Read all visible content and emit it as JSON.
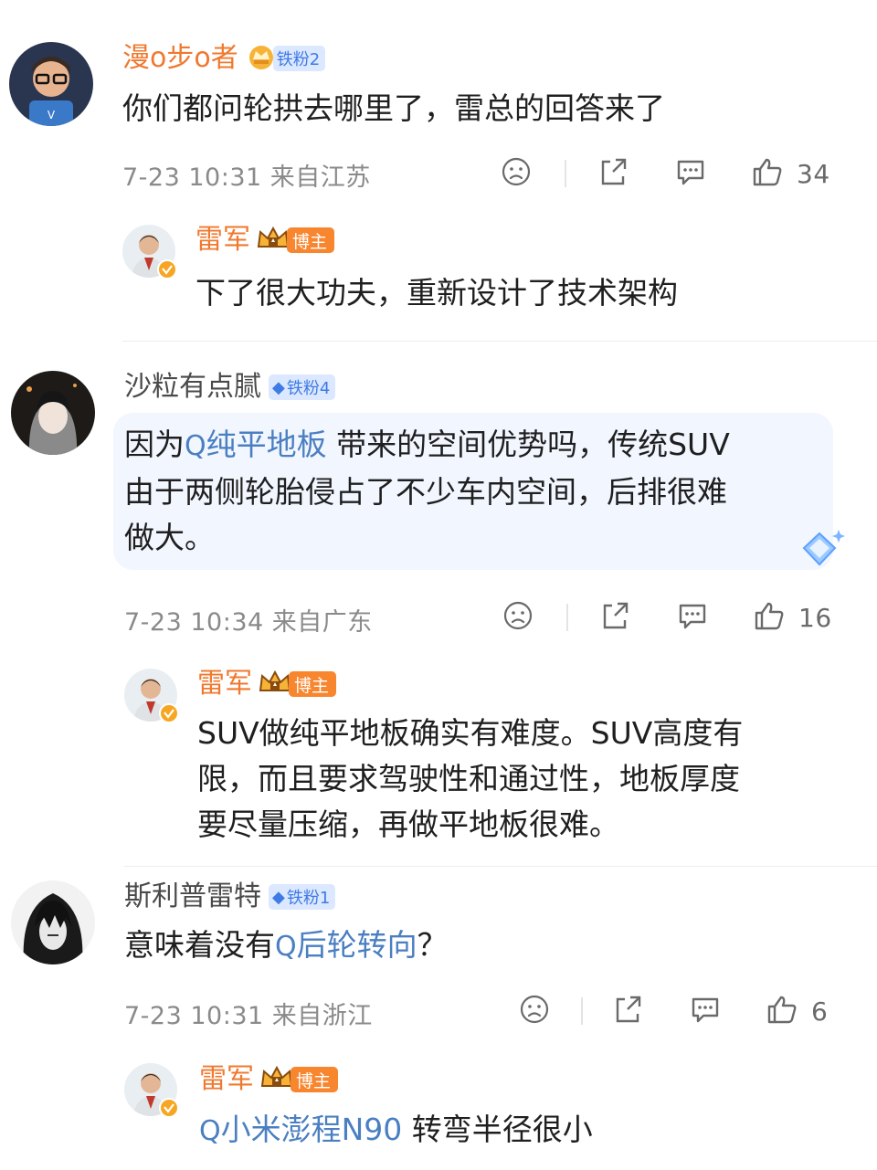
{
  "comments": [
    {
      "username": "漫o步o者",
      "badge": "铁粉2",
      "text": "你们都问轮拱去哪里了，雷总的回答来了",
      "meta": "7-23 10:31 来自江苏",
      "likes": "34",
      "reply": {
        "username": "雷军",
        "badge": "博主",
        "text": "下了很大功夫，重新设计了技术架构"
      }
    },
    {
      "username": "沙粒有点腻",
      "badge": "铁粉4",
      "text_pre": "因为",
      "topic": "纯平地板",
      "text_line1_post": " 带来的空间优势吗，传统SUV",
      "text_line2": "由于两侧轮胎侵占了不少车内空间，后排很难",
      "text_line3": "做大。",
      "meta": "7-23 10:34 来自广东",
      "likes": "16",
      "reply": {
        "username": "雷军",
        "badge": "博主",
        "line1": "SUV做纯平地板确实有难度。SUV高度有",
        "line2": "限，而且要求驾驶性和通过性，地板厚度",
        "line3": "要尽量压缩，再做平地板很难。"
      }
    },
    {
      "username": "斯利普雷特",
      "badge": "铁粉1",
      "text_pre": "意味着没有",
      "topic": "后轮转向",
      "text_post": "？",
      "meta": "7-23 10:31 来自浙江",
      "likes": "6",
      "reply": {
        "username": "雷军",
        "badge": "博主",
        "topic": "小米澎程N90",
        "text_post": " 转弯半径很小"
      }
    }
  ],
  "colors": {
    "username_orange": "#f0792f",
    "link_blue": "#4a7fc1",
    "meta_gray": "#8a8a8a"
  }
}
